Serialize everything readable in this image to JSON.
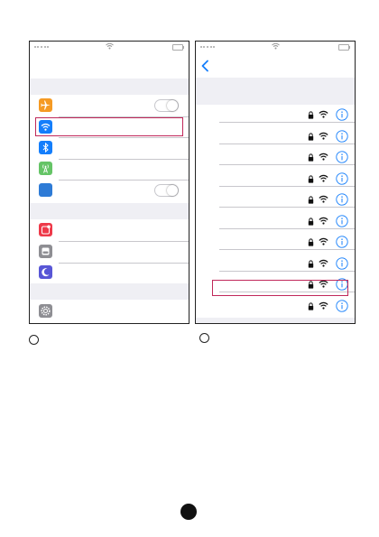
{
  "colors": {
    "highlight": "#c0285a",
    "ios_blue": "#147efb",
    "group_gray": "#efeff4"
  },
  "left_screen": {
    "rows": [
      {
        "icon": "airplane-icon",
        "color": "#f59a23",
        "toggle": "off"
      },
      {
        "icon": "wifi-icon",
        "color": "#147efb",
        "highlighted": true
      },
      {
        "icon": "bluetooth-icon",
        "color": "#147efb"
      },
      {
        "icon": "cellular-icon",
        "color": "#65c466"
      },
      {
        "icon": "vpn-icon",
        "color": "#2e7bd6",
        "toggle": "off"
      },
      {
        "icon": "notifications-icon",
        "color": "#ee3a4a"
      },
      {
        "icon": "control-center-icon",
        "color": "#8e8e93"
      },
      {
        "icon": "do-not-disturb-icon",
        "color": "#5856d6"
      },
      {
        "icon": "general-settings-icon",
        "color": "#8e8e93"
      }
    ]
  },
  "right_screen": {
    "network_rows": 10,
    "highlighted_row": 9,
    "row_icons": [
      "lock-icon",
      "wifi-icon",
      "info-icon"
    ]
  },
  "steps": {
    "left": "",
    "right": ""
  },
  "page_number": ""
}
